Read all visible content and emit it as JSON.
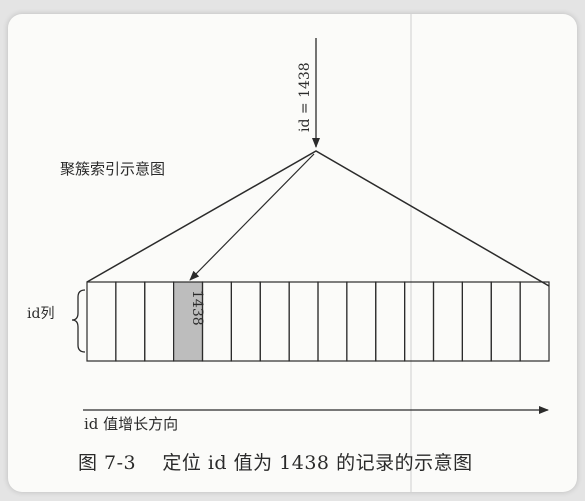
{
  "diagram": {
    "title": "聚簇索引示意图",
    "search_key": "id = 1438",
    "row_label": "id列",
    "highlight_value": "1438",
    "direction_label": "id 值增长方向",
    "cell_count": 16,
    "highlight_index": 3,
    "colors": {
      "line": "#2b2b2b",
      "highlight_fill": "#bdbdbd",
      "background": "#fbfbf9"
    }
  },
  "caption": {
    "figure_number": "图 7-3",
    "text": "定位 id 值为 1438 的记录的示意图"
  }
}
